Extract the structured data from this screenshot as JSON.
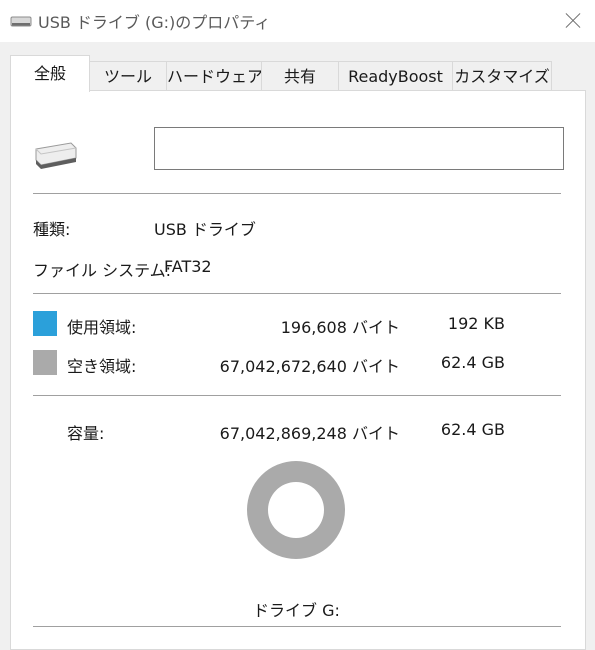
{
  "window": {
    "title": "USB ドライブ (G:)のプロパティ"
  },
  "tabs": [
    {
      "label": "全般",
      "active": true
    },
    {
      "label": "ツール"
    },
    {
      "label": "ハードウェア"
    },
    {
      "label": "共有"
    },
    {
      "label": "ReadyBoost"
    },
    {
      "label": "カスタマイズ"
    }
  ],
  "general": {
    "volume_label_value": "",
    "type_label": "種類:",
    "type_value": "USB ドライブ",
    "filesystem_label": "ファイル システム:",
    "filesystem_value": "FAT32",
    "used": {
      "label": "使用領域:",
      "bytes": "196,608 バイト",
      "size": "192 KB",
      "color": "#2ba0da"
    },
    "free": {
      "label": "空き領域:",
      "bytes": "67,042,672,640 バイト",
      "size": "62.4 GB",
      "color": "#aaaaaa"
    },
    "capacity": {
      "label": "容量:",
      "bytes": "67,042,869,248 バイト",
      "size": "62.4 GB"
    },
    "drive_caption": "ドライブ G:"
  },
  "chart_data": {
    "type": "pie",
    "categories": [
      "使用領域",
      "空き領域"
    ],
    "values": [
      196608,
      67042672640
    ],
    "colors": [
      "#2ba0da",
      "#aaaaaa"
    ]
  }
}
